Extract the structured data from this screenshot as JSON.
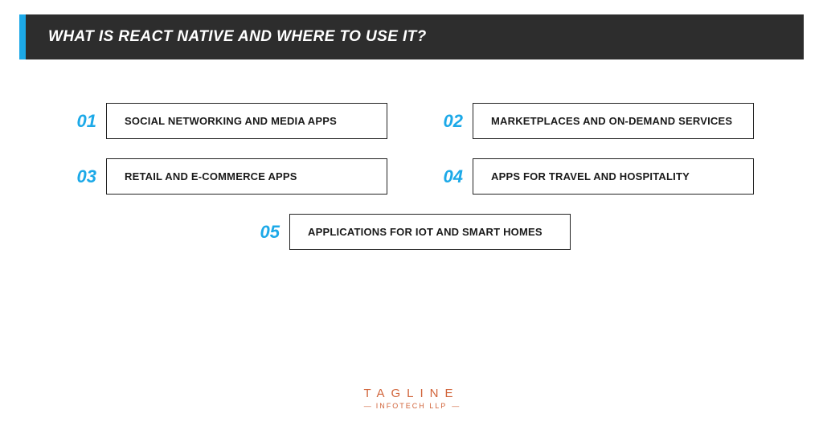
{
  "header": {
    "title": "WHAT IS REACT NATIVE AND WHERE TO USE IT?"
  },
  "items": [
    {
      "num": "01",
      "label": "SOCIAL NETWORKING AND MEDIA APPS"
    },
    {
      "num": "02",
      "label": "MARKETPLACES AND ON-DEMAND SERVICES"
    },
    {
      "num": "03",
      "label": "RETAIL AND E-COMMERCE APPS"
    },
    {
      "num": "04",
      "label": "APPS FOR TRAVEL AND HOSPITALITY"
    },
    {
      "num": "05",
      "label": "APPLICATIONS FOR IOT AND SMART HOMES"
    }
  ],
  "footer": {
    "brand_top": "TAGLINE",
    "brand_bottom": "INFOTECH LLP"
  },
  "colors": {
    "accent": "#1ca9e8",
    "header_bg": "#2d2d2d",
    "brand": "#d1643a"
  }
}
